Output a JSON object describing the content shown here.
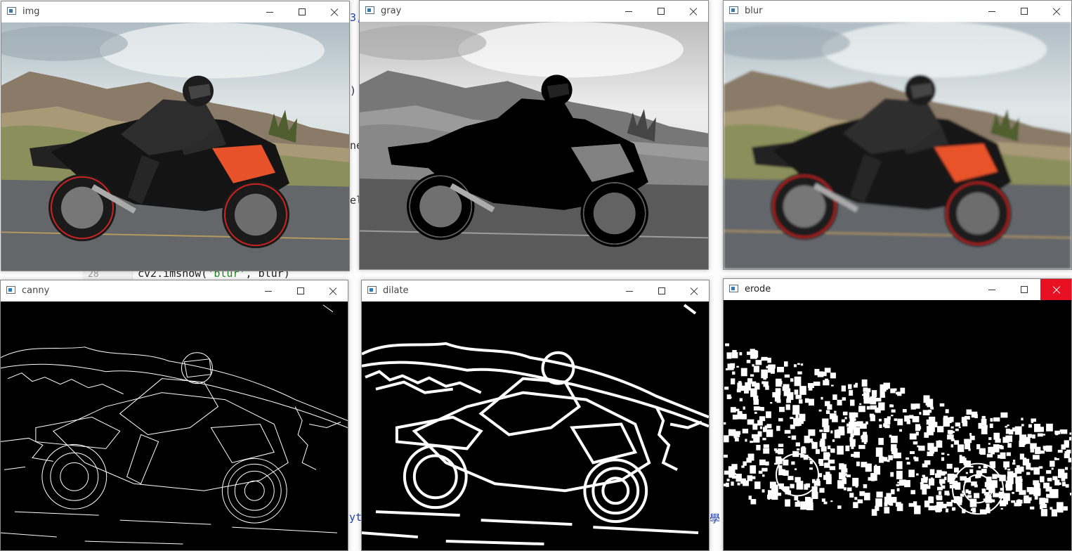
{
  "editor": {
    "line_number": "28",
    "code_prefix": "cv2.imshow(",
    "code_string": "'blur'",
    "code_suffix": ", blur)",
    "fragments": [
      "3,",
      "ne",
      "el",
      ")",
      "yt",
      "學"
    ]
  },
  "windows": [
    {
      "title": "img"
    },
    {
      "title": "gray"
    },
    {
      "title": "blur"
    },
    {
      "title": "canny"
    },
    {
      "title": "dilate"
    },
    {
      "title": "erode"
    }
  ],
  "colors": {
    "fairing_accent": "#e8522a",
    "close_hover": "#e81123",
    "edge_black": "#000000",
    "edge_white": "#ffffff"
  },
  "icons": {
    "window": "app-window-icon",
    "minimize": "minimize-icon",
    "maximize": "maximize-icon",
    "close": "close-icon"
  }
}
